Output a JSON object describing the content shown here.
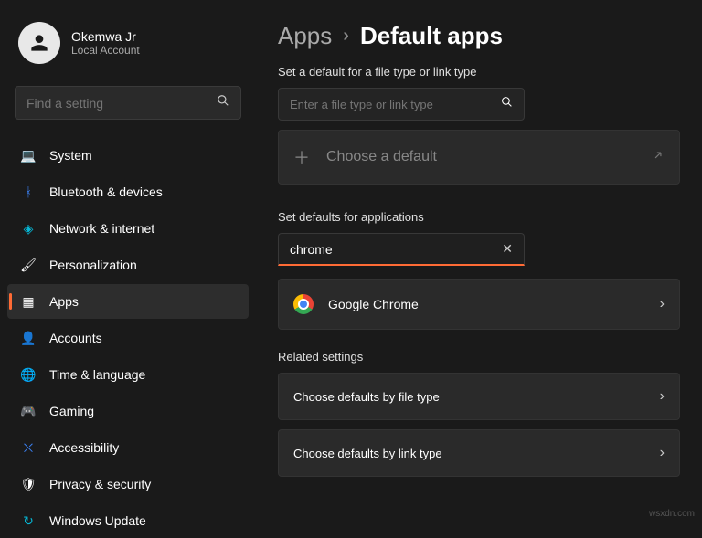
{
  "profile": {
    "name": "Okemwa Jr",
    "sub": "Local Account"
  },
  "search": {
    "placeholder": "Find a setting"
  },
  "nav": {
    "system": "System",
    "bluetooth": "Bluetooth & devices",
    "network": "Network & internet",
    "personalization": "Personalization",
    "apps": "Apps",
    "accounts": "Accounts",
    "time": "Time & language",
    "gaming": "Gaming",
    "accessibility": "Accessibility",
    "privacy": "Privacy & security",
    "update": "Windows Update"
  },
  "breadcrumb": {
    "parent": "Apps",
    "current": "Default apps"
  },
  "section1": {
    "label": "Set a default for a file type or link type",
    "placeholder": "Enter a file type or link type",
    "choose": "Choose a default"
  },
  "section2": {
    "label": "Set defaults for applications",
    "value": "chrome",
    "result": "Google Chrome"
  },
  "related": {
    "label": "Related settings",
    "byFile": "Choose defaults by file type",
    "byLink": "Choose defaults by link type"
  },
  "watermark": "wsxdn.com"
}
